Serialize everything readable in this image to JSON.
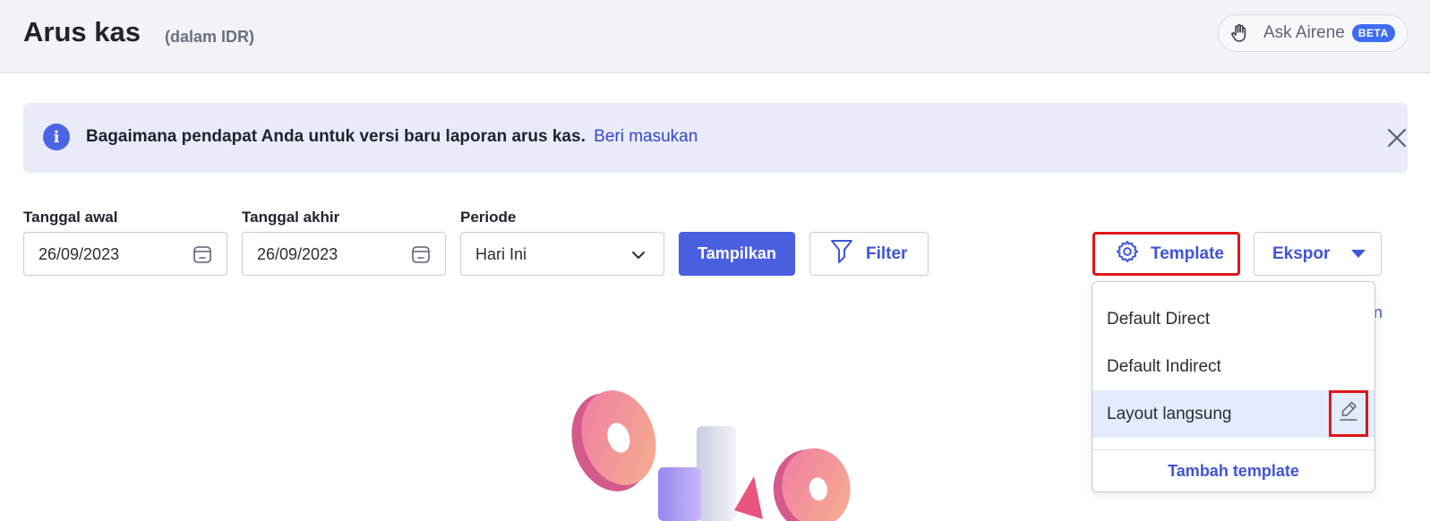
{
  "header": {
    "title": "Arus kas",
    "subtitle": "(dalam IDR)",
    "assistant_label": "Ask Airene",
    "assistant_badge": "BETA"
  },
  "banner": {
    "message": "Bagaimana pendapat Anda untuk versi baru laporan arus kas.",
    "link_text": "Beri masukan"
  },
  "filters": {
    "start_date_label": "Tanggal awal",
    "start_date_value": "26/09/2023",
    "end_date_label": "Tanggal akhir",
    "end_date_value": "26/09/2023",
    "period_label": "Periode",
    "period_value": "Hari Ini"
  },
  "toolbar": {
    "show_label": "Tampilkan",
    "filter_label": "Filter",
    "template_label": "Template",
    "export_label": "Ekspor"
  },
  "partial_link": "n",
  "template_menu": {
    "items": [
      {
        "label": "Default Direct"
      },
      {
        "label": "Default Indirect"
      },
      {
        "label": "Layout langsung",
        "selected": true
      }
    ],
    "add_label": "Tambah template"
  },
  "colors": {
    "primary": "#4a5fe0",
    "link": "#3f55d8",
    "highlight": "#e0151a",
    "banner_bg": "#e9ebfa"
  },
  "icons": {
    "assistant": "hand-icon",
    "info": "info-icon",
    "close": "close-icon",
    "calendar": "calendar-icon",
    "chevron": "chevron-down-icon",
    "filter": "filter-icon",
    "template": "gear-icon",
    "export_caret": "caret-down-icon",
    "edit": "pencil-icon"
  }
}
